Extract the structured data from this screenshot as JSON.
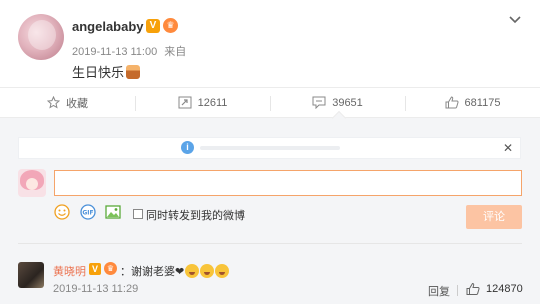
{
  "post": {
    "username": "angelababy",
    "verified_badge": "V",
    "membership_badge": "vip-crown-icon",
    "timestamp": "2019-11-13 11:00",
    "source": "来自",
    "content": "生日快乐",
    "content_emoji": "cake-icon"
  },
  "actions": {
    "favorite_label": "收藏",
    "repost_count": "12611",
    "comment_count": "39651",
    "like_count": "681175"
  },
  "composer": {
    "input_value": "",
    "input_placeholder": "",
    "repost_checkbox_label": "同时转发到我的微博",
    "repost_checked": false,
    "submit_label": "评论"
  },
  "comment": {
    "author": "黄晓明",
    "verified_badge": "V",
    "membership_badge": "vip-crown-icon",
    "separator": "：",
    "text": "谢谢老婆",
    "emojis": [
      "heart-icon",
      "smile-face-icon",
      "smile-face-icon",
      "smile-face-icon"
    ],
    "timestamp": "2019-11-13 11:29",
    "reply_label": "回复",
    "like_count": "124870"
  },
  "colors": {
    "accent_orange": "#eb7350",
    "input_border": "#f5a46a",
    "submit_bg": "#fcc4a3",
    "panel_bg": "#f4f5f7",
    "verified_gold": "#f7a10a"
  }
}
